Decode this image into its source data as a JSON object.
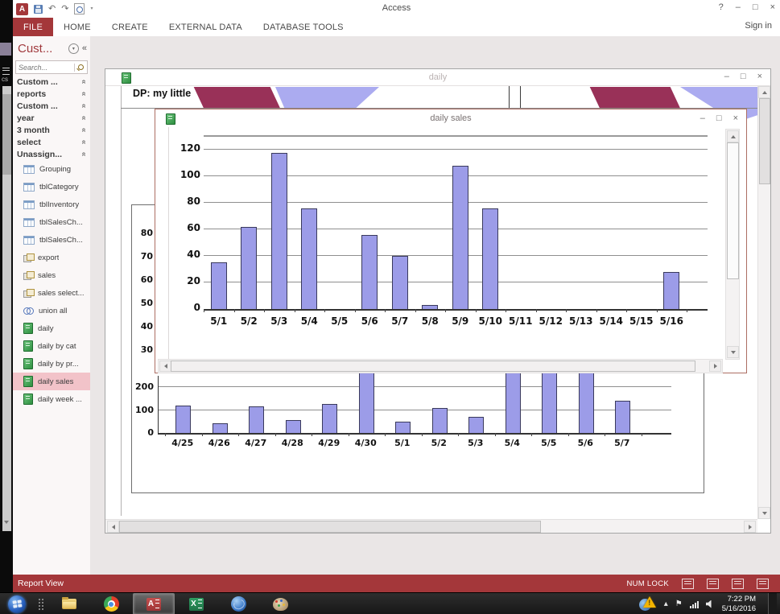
{
  "app": {
    "title": "Access",
    "help_glyph": "?",
    "min_glyph": "–",
    "max_glyph": "□",
    "close_glyph": "×",
    "sign_in": "Sign in",
    "qat": {
      "logo_letter": "A",
      "undo_glyph": "↶",
      "redo_glyph": "↷",
      "dropdown_glyph": "▾"
    }
  },
  "ribbon": {
    "tabs": [
      {
        "label": "FILE",
        "active": true
      },
      {
        "label": "HOME",
        "active": false
      },
      {
        "label": "CREATE",
        "active": false
      },
      {
        "label": "EXTERNAL DATA",
        "active": false
      },
      {
        "label": "DATABASE TOOLS",
        "active": false
      }
    ]
  },
  "nav": {
    "title": "Cust...",
    "menu_glyph": "▾",
    "collapse_glyph": "«",
    "chevron_glyph": "«",
    "search_placeholder": "Search...",
    "groups": [
      "Custom ...",
      "reports",
      "Custom ...",
      "year",
      "3 month",
      "select",
      "Unassign..."
    ],
    "items": [
      {
        "label": "Grouping",
        "icon": "table",
        "selected": false
      },
      {
        "label": "tblCategory",
        "icon": "table",
        "selected": false
      },
      {
        "label": "tblInventory",
        "icon": "table",
        "selected": false
      },
      {
        "label": "tblSalesCh...",
        "icon": "table",
        "selected": false
      },
      {
        "label": "tblSalesCh...",
        "icon": "table",
        "selected": false
      },
      {
        "label": "export",
        "icon": "query",
        "selected": false
      },
      {
        "label": "sales",
        "icon": "query",
        "selected": false
      },
      {
        "label": "sales select...",
        "icon": "query",
        "selected": false
      },
      {
        "label": "union all",
        "icon": "union",
        "selected": false
      },
      {
        "label": "daily",
        "icon": "report",
        "selected": false
      },
      {
        "label": "daily by cat",
        "icon": "report",
        "selected": false
      },
      {
        "label": "daily by pr...",
        "icon": "report",
        "selected": false
      },
      {
        "label": "daily sales",
        "icon": "report",
        "selected": true
      },
      {
        "label": "daily week ...",
        "icon": "report",
        "selected": false
      }
    ]
  },
  "windows": {
    "daily": {
      "title": "daily",
      "min_glyph": "–",
      "max_glyph": "□",
      "close_glyph": "×",
      "header_text": "DP: my little",
      "hidden_axis_labels": [
        "80",
        "70",
        "60",
        "50",
        "40",
        "30"
      ]
    },
    "daily_sales": {
      "title": "daily sales",
      "min_glyph": "–",
      "max_glyph": "□",
      "close_glyph": "×"
    }
  },
  "chart_data": [
    {
      "id": "daily_sales_popup",
      "type": "bar",
      "title": "daily sales",
      "categories": [
        "5/1",
        "5/2",
        "5/3",
        "5/4",
        "5/5",
        "5/6",
        "5/7",
        "5/8",
        "5/9",
        "5/10",
        "5/11",
        "5/12",
        "5/13",
        "5/14",
        "5/15",
        "5/16"
      ],
      "values": [
        35,
        62,
        118,
        76,
        0,
        56,
        40,
        3,
        108,
        76,
        0,
        0,
        0,
        0,
        0,
        28
      ],
      "xlabel": "",
      "ylabel": "",
      "ylim": [
        0,
        130
      ],
      "yticks": [
        0,
        20,
        40,
        60,
        80,
        100,
        120
      ],
      "grid": true,
      "legend": false
    },
    {
      "id": "daily_report_bottom",
      "type": "bar",
      "title": "",
      "categories": [
        "4/25",
        "4/26",
        "4/27",
        "4/28",
        "4/29",
        "4/30",
        "5/1",
        "5/2",
        "5/3",
        "5/4",
        "5/5",
        "5/6",
        "5/7"
      ],
      "values": [
        120,
        42,
        118,
        55,
        128,
        250,
        50,
        108,
        70,
        250,
        250,
        250,
        140
      ],
      "clipped_indices": [
        5,
        9,
        10,
        11
      ],
      "note": "bars at clipped indices extend above the visible area; occluded by the daily sales window",
      "xlabel": "",
      "ylabel": "",
      "ylim": [
        0,
        250
      ],
      "yticks": [
        0,
        100,
        200
      ],
      "grid": true,
      "legend": false
    }
  ],
  "status_bar": {
    "view_label": "Report View",
    "num_lock": "NUM LOCK"
  },
  "taskbar": {
    "apps": [
      {
        "name": "start",
        "letter": "",
        "active": false
      },
      {
        "name": "pinned-dots",
        "letter": "",
        "active": false
      },
      {
        "name": "explorer",
        "letter": "",
        "active": false
      },
      {
        "name": "chrome",
        "letter": "",
        "active": false
      },
      {
        "name": "access",
        "letter": "A",
        "active": true
      },
      {
        "name": "excel",
        "letter": "X",
        "active": false
      },
      {
        "name": "sync",
        "letter": "",
        "active": false
      },
      {
        "name": "paint",
        "letter": "",
        "active": false
      }
    ],
    "tray": {
      "warning_glyph": "!",
      "caret_glyph": "▴",
      "flag_glyph": "⚑",
      "time": "7:22 PM",
      "date": "5/16/2016"
    }
  },
  "colors": {
    "accent_red": "#A4373A",
    "bar_fill": "#9C9CE8",
    "bar_border": "#3A3A5C",
    "maroon": "#993158",
    "periwinkle": "#ABABF0",
    "nav_selected": "#F2C3C9",
    "popup_border": "#AC6E63"
  }
}
